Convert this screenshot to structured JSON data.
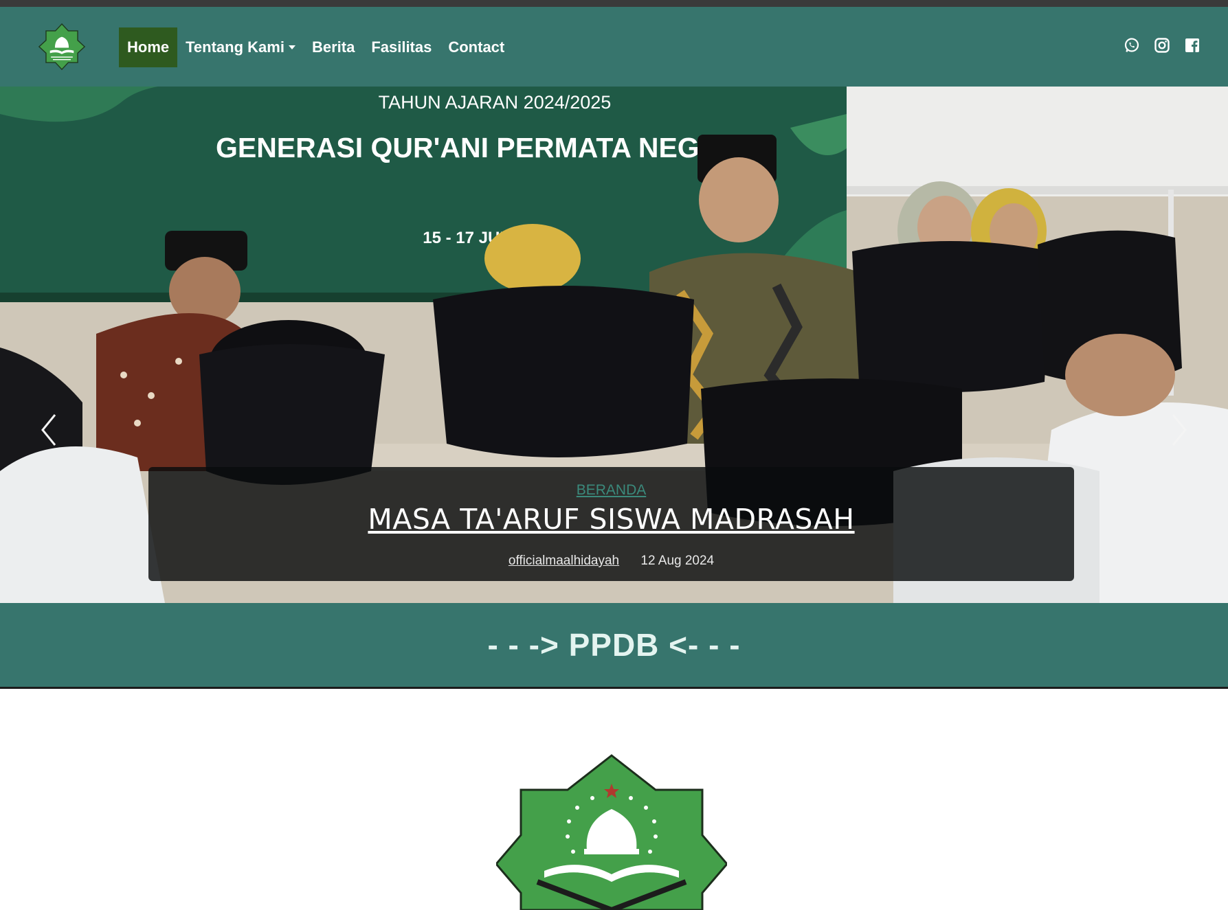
{
  "nav": {
    "items": [
      {
        "label": "Home",
        "active": true
      },
      {
        "label": "Tentang Kami",
        "dropdown": true
      },
      {
        "label": "Berita"
      },
      {
        "label": "Fasilitas"
      },
      {
        "label": "Contact"
      }
    ]
  },
  "social": [
    "whatsapp-icon",
    "instagram-icon",
    "facebook-icon"
  ],
  "hero": {
    "banner_line1": "TAHUN AJARAN 2024/2025",
    "banner_line2": "GENERASI QUR'ANI PERMATA NEGERI",
    "banner_line3": "15 - 17 JULI 2024",
    "category": "BERANDA",
    "title": "MASA TA'ARUF SISWA MADRASAH",
    "author": "officialmaalhidayah",
    "date": "12 Aug 2024"
  },
  "ppdb": {
    "label": "- - -> PPDB <- - -"
  },
  "colors": {
    "primary": "#37756d",
    "active": "#2e5a1f",
    "logo_green": "#44a04a"
  }
}
